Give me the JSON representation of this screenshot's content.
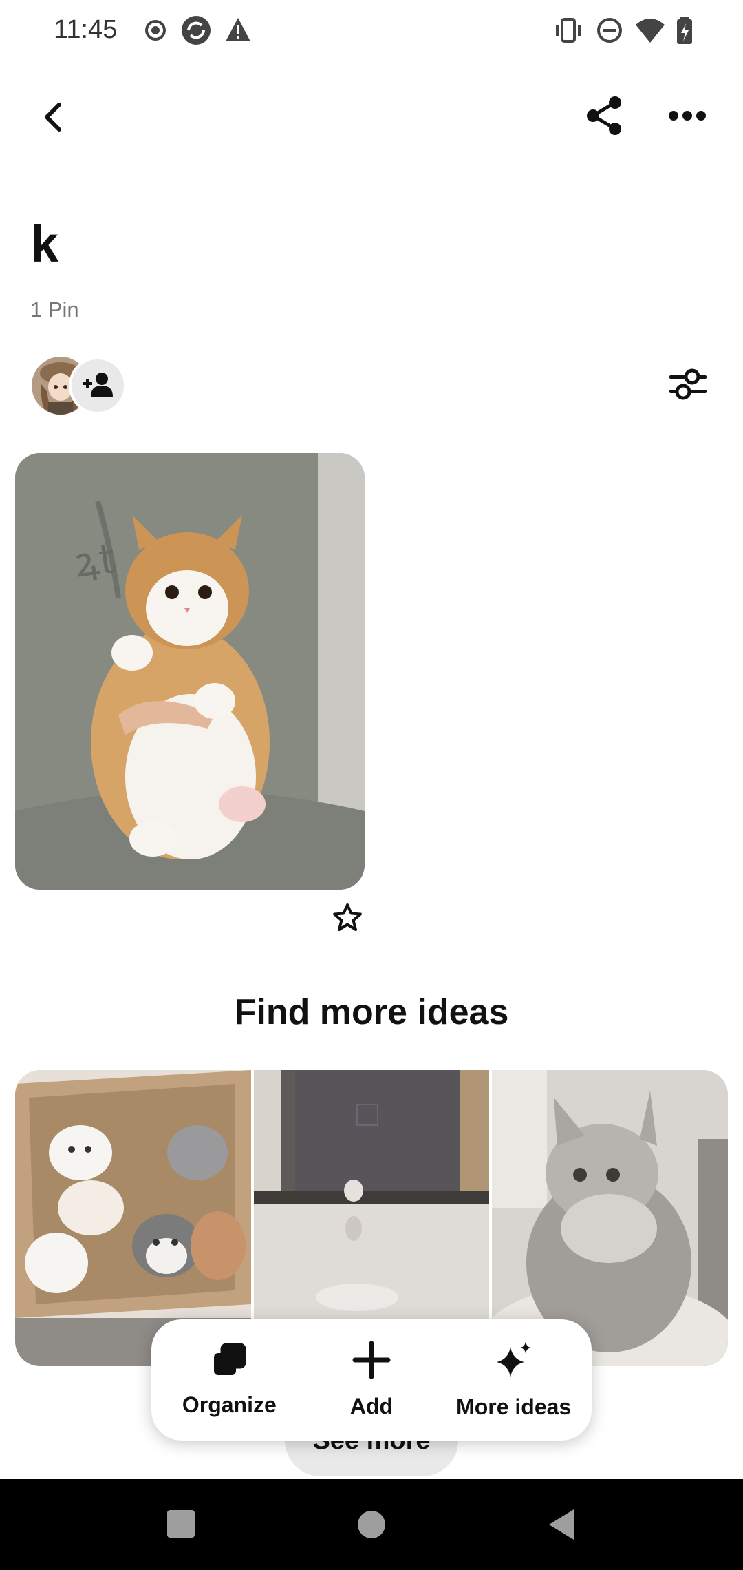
{
  "status_bar": {
    "time": "11:45",
    "left_icons": [
      "record-icon",
      "sync-icon",
      "warning-icon"
    ],
    "right_icons": [
      "vibrate-icon",
      "dnd-icon",
      "wifi-icon",
      "battery-icon"
    ]
  },
  "toolbar": {
    "back_icon": "chevron-left-icon",
    "share_icon": "share-icon",
    "more_icon": "more-horizontal-icon"
  },
  "board": {
    "title": "k",
    "pin_count": "1 Pin",
    "filter_icon": "sliders-icon"
  },
  "find_more": {
    "title": "Find more ideas",
    "see_more": "See more"
  },
  "actions": [
    {
      "label": "Organize",
      "icon": "organize-icon"
    },
    {
      "label": "Add",
      "icon": "plus-icon"
    },
    {
      "label": "More ideas",
      "icon": "sparkle-icon"
    }
  ],
  "colors": {
    "text": "#111111",
    "secondary_text": "#767676",
    "pill_bg": "#e9e9e9"
  }
}
